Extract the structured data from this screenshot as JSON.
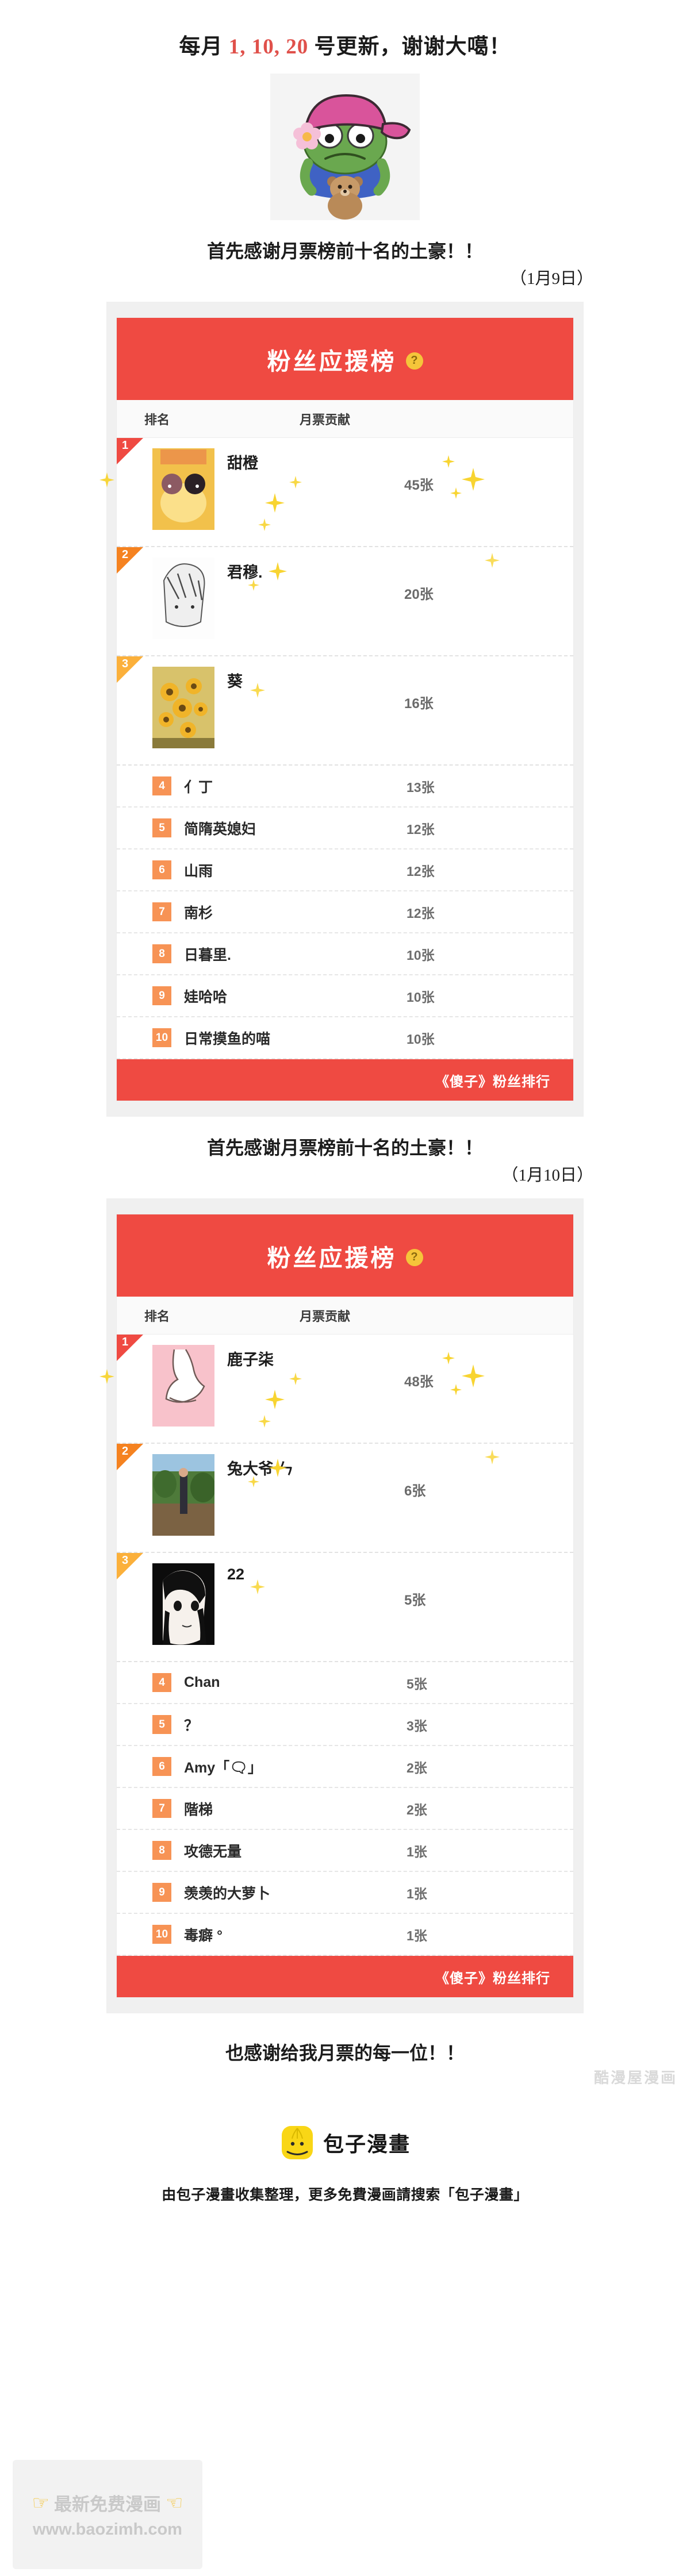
{
  "header": {
    "line_prefix": "每月 ",
    "line_numbers": "1, 10, 20",
    "line_suffix": " 号更新，谢谢大噶！"
  },
  "sticker": {
    "name": "pepe-frog-with-pink-cap-and-teddy-bear"
  },
  "sections": [
    {
      "heading": "首先感谢月票榜前十名的土豪！！",
      "date": "（1月9日）",
      "panel": {
        "title": "粉丝应援榜",
        "help_badge": "?",
        "columns": {
          "rank": "排名",
          "votes": "月票贡献"
        },
        "footer": "《傻子》粉丝排行",
        "top_rows": [
          {
            "rank": "1",
            "name": "甜橙",
            "votes": "45张",
            "avatar": "orange-chibi-couple"
          },
          {
            "rank": "2",
            "name": "君穆.",
            "votes": "20张",
            "avatar": "manga-boy-sketch"
          },
          {
            "rank": "3",
            "name": "葵",
            "votes": "16张",
            "avatar": "sunflowers-painting"
          }
        ],
        "plain_rows": [
          {
            "rank": "4",
            "name": "亻丁",
            "votes": "13张"
          },
          {
            "rank": "5",
            "name": "简隋英媳妇",
            "votes": "12张"
          },
          {
            "rank": "6",
            "name": "山雨",
            "votes": "12张"
          },
          {
            "rank": "7",
            "name": "南杉",
            "votes": "12张"
          },
          {
            "rank": "8",
            "name": "日暮里.",
            "votes": "10张"
          },
          {
            "rank": "9",
            "name": "娃哈哈",
            "votes": "10张"
          },
          {
            "rank": "10",
            "name": "日常摸鱼的喵",
            "votes": "10张"
          }
        ]
      }
    },
    {
      "heading": "首先感谢月票榜前十名的土豪！！",
      "date": "（1月10日）",
      "panel": {
        "title": "粉丝应援榜",
        "help_badge": "?",
        "columns": {
          "rank": "排名",
          "votes": "月票贡献"
        },
        "footer": "《傻子》粉丝排行",
        "top_rows": [
          {
            "rank": "1",
            "name": "鹿子柒",
            "votes": "48张",
            "avatar": "pink-bunny-drawing"
          },
          {
            "rank": "2",
            "name": "兔大爷 ㄣ",
            "votes": "6张",
            "avatar": "outdoor-photo"
          },
          {
            "rank": "3",
            "name": "22",
            "votes": "5张",
            "avatar": "manga-girl-portrait"
          }
        ],
        "plain_rows": [
          {
            "rank": "4",
            "name": "Chan",
            "votes": "5张"
          },
          {
            "rank": "5",
            "name": "？",
            "votes": "3张"
          },
          {
            "rank": "6",
            "name": "Amy「🗨」",
            "votes": "2张"
          },
          {
            "rank": "7",
            "name": "階梯",
            "votes": "2张"
          },
          {
            "rank": "8",
            "name": "攻德无量",
            "votes": "1张"
          },
          {
            "rank": "9",
            "name": "羡羡的大萝卜",
            "votes": "1张"
          },
          {
            "rank": "10",
            "name": "毒癖 °",
            "votes": "1张"
          }
        ]
      }
    }
  ],
  "closing": "也感谢给我月票的每一位！！",
  "mid_watermark": "酷漫屋漫画",
  "site_footer": {
    "brand_name": "包子漫畫",
    "note": "由包子漫畫收集整理，更多免費漫画請搜索「包子漫畫」",
    "watermark_line1": "最新免费漫画",
    "watermark_line2": "www.baozimh.com"
  },
  "colors": {
    "brand_red": "#ef4a42",
    "rank1": "#ef4a42",
    "rank2": "#f58220",
    "rank3": "#fbb03b",
    "chip_orange": "#f79355",
    "accent_yellow": "#f5c53a"
  }
}
